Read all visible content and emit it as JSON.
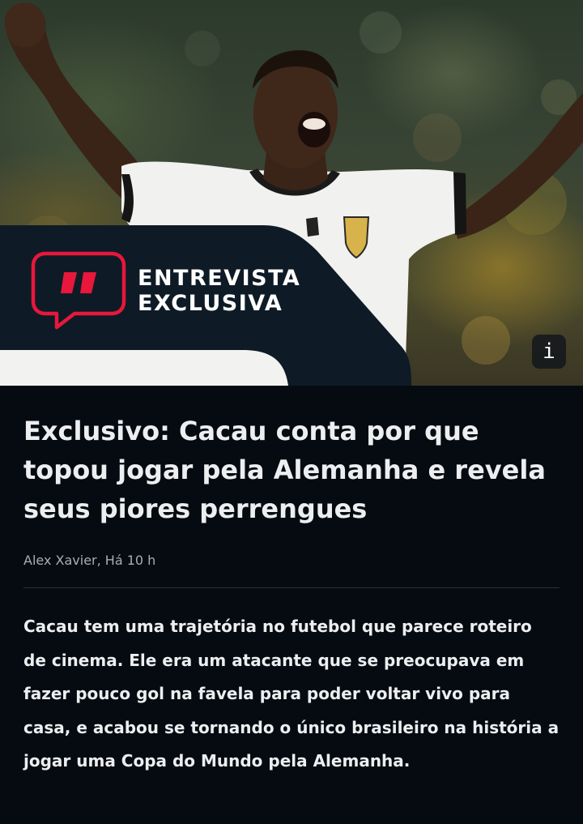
{
  "hero": {
    "image_alt": "Cacau",
    "banner_line1": "Entrevista",
    "banner_line2": "Exclusiva",
    "info_button_label": "i"
  },
  "article": {
    "headline": "Exclusivo: Cacau conta por que topou jogar pela Alemanha e revela seus piores perrengues",
    "author": "Alex Xavier",
    "separator": ", ",
    "time": "Há 10 h",
    "body": "Cacau tem uma trajetória no futebol que parece roteiro de cinema. Ele era um atacante que se preocupava em fazer pouco gol na favela para poder voltar vivo para casa, e acabou se tornando o único brasileiro na história a jogar uma Copa do Mundo pela Alemanha."
  },
  "colors": {
    "background": "#050b11",
    "banner": "#0e1b26",
    "accent": "#e8173b",
    "text": "#eceef0",
    "muted": "#a8adb3"
  },
  "icons": {
    "banner_logo": "quote-speech-bubble-icon",
    "info": "info-icon"
  }
}
